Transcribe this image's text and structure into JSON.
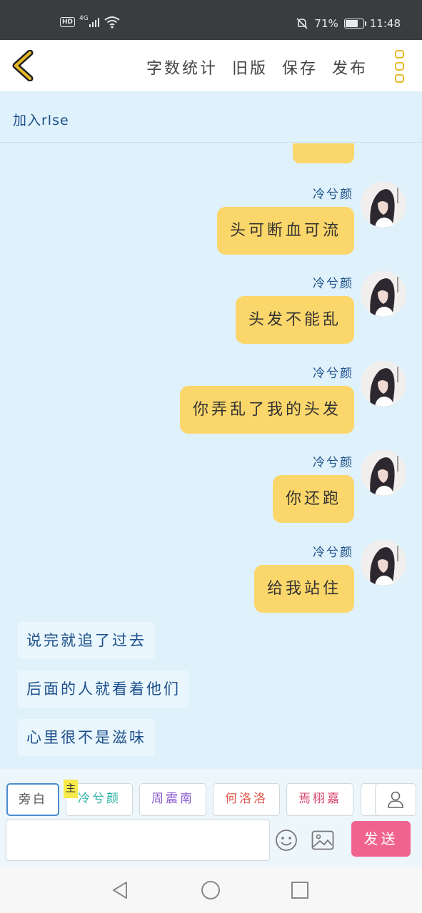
{
  "status_bar": {
    "network": "4G",
    "hd": "HD",
    "battery_text": "71%",
    "battery_level": 0.71,
    "time": "11:48"
  },
  "header": {
    "menu": [
      {
        "label": "字数统计"
      },
      {
        "label": "旧版"
      },
      {
        "label": "保存"
      },
      {
        "label": "发布"
      }
    ]
  },
  "join_bar": {
    "text": "加入rlse"
  },
  "messages": [
    {
      "name": "冷兮颜",
      "text": "头可断血可流"
    },
    {
      "name": "冷兮颜",
      "text": "头发不能乱"
    },
    {
      "name": "冷兮颜",
      "text": "你弄乱了我的头发"
    },
    {
      "name": "冷兮颜",
      "text": "你还跑"
    },
    {
      "name": "冷兮颜",
      "text": "给我站住"
    }
  ],
  "narrations": [
    {
      "text": "说完就追了过去"
    },
    {
      "text": "后面的人就看着他们"
    },
    {
      "text": "心里很不是滋味"
    }
  ],
  "roles": [
    {
      "label": "旁白",
      "color": "#555555"
    },
    {
      "label": "冷兮颜",
      "color": "#2bb3a3",
      "tag": "主"
    },
    {
      "label": "周震南",
      "color": "#8a5bd0"
    },
    {
      "label": "何洛洛",
      "color": "#e05a4f"
    },
    {
      "label": "焉栩嘉",
      "color": "#d8456e"
    }
  ],
  "composer": {
    "send_label": "发送"
  },
  "icons": {
    "back": "chevron-left-icon",
    "more": "more-vertical-icon",
    "emoji": "smiley-icon",
    "image": "image-icon",
    "user": "user-icon"
  },
  "colors": {
    "accent_yellow": "#fbd66a",
    "chat_bg": "#dff1fb",
    "name_blue": "#1b4f8a",
    "send_pink": "#f0638f"
  }
}
